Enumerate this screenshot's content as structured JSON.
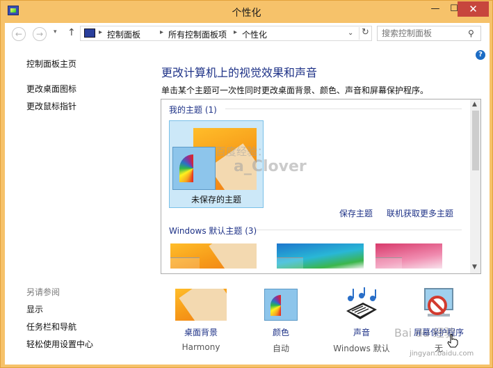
{
  "window": {
    "title": "个性化",
    "minimize_glyph": "—",
    "maximize_glyph": "☐",
    "close_glyph": "✕"
  },
  "addressbar": {
    "back_glyph": "←",
    "forward_glyph": "→",
    "recent_glyph": "▾",
    "up_glyph": "↑",
    "breadcrumb": [
      "控制面板",
      "所有控制面板项",
      "个性化"
    ],
    "separator_glyph": "▸",
    "dropdown_glyph": "⌄",
    "refresh_glyph": "↻",
    "search_placeholder": "搜索控制面板",
    "search_glyph": "⚲"
  },
  "help_glyph": "?",
  "sidebar": {
    "home_link": "控制面板主页",
    "links": [
      "更改桌面图标",
      "更改鼠标指针"
    ],
    "see_also_label": "另请参阅",
    "see_also_links": [
      "显示",
      "任务栏和导航",
      "轻松使用设置中心"
    ]
  },
  "main": {
    "heading": "更改计算机上的视觉效果和声音",
    "description": "单击某个主题可一次性同时更改桌面背景、颜色、声音和屏幕保护程序。"
  },
  "themes": {
    "my_themes_header": "我的主题 (1)",
    "unsaved_theme_label": "未保存的主题",
    "save_theme_link": "保存主题",
    "get_more_link": "联机获取更多主题",
    "default_themes_header": "Windows 默认主题 (3)",
    "scroll_up_glyph": "▲",
    "scroll_down_glyph": "▼"
  },
  "bottom": {
    "desktop_background": {
      "label": "桌面背景",
      "value": "Harmony"
    },
    "color": {
      "label": "颜色",
      "value": "自动"
    },
    "sound": {
      "label": "声音",
      "value": "Windows 默认"
    },
    "screensaver": {
      "label": "屏幕保护程序",
      "value": "无"
    }
  },
  "watermarks": {
    "site": "jingyan.baidu.com",
    "brand": "Bai du 经验",
    "overlay_top": "百度经验：",
    "overlay_bottom": "a_Clover"
  },
  "colors": {
    "title_bar": "#f6c26a",
    "link_blue": "#1e3287",
    "selection_bg": "#cce8f8",
    "close_red": "#c7463d"
  }
}
